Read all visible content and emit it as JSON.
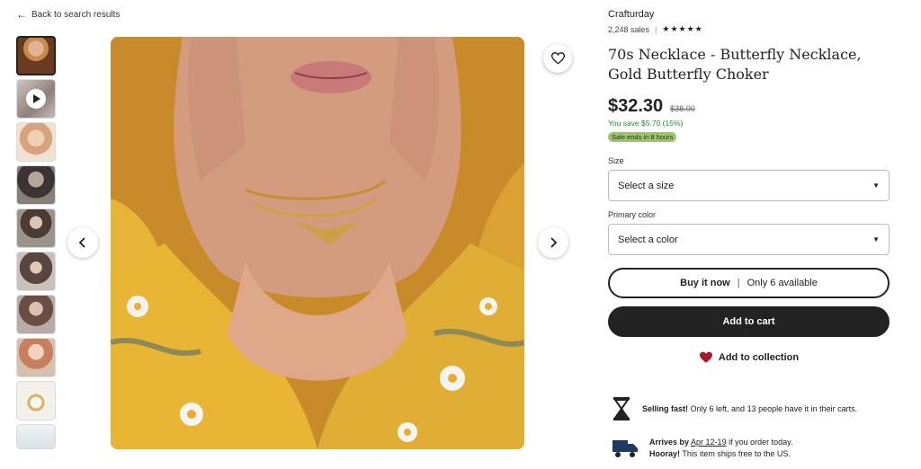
{
  "nav": {
    "back_label": "Back to search results"
  },
  "shop": {
    "name": "Crafturday",
    "sales": "2,248 sales",
    "stars": "★★★★★"
  },
  "product": {
    "title": "70s Necklace - Butterfly Necklace, Gold Butterfly Choker",
    "price": "$32.30",
    "original_price": "$38.00",
    "savings": "You save $5.70 (15%)",
    "sale_badge": "Sale ends in 8 hours"
  },
  "options": {
    "size_label": "Size",
    "size_placeholder": "Select a size",
    "color_label": "Primary color",
    "color_placeholder": "Select a color"
  },
  "actions": {
    "buy_now": "Buy it now",
    "buy_now_stock": "Only 6 available",
    "add_to_cart": "Add to cart",
    "add_to_collection": "Add to collection"
  },
  "info": {
    "selling_fast_bold": "Selling fast!",
    "selling_fast_text": "Only 6 left, and 13 people have it in their carts.",
    "arrives_bold": "Arrives by",
    "arrives_date": "Apr 12-19",
    "arrives_text": "if you order today.",
    "hooray_bold": "Hooray!",
    "hooray_text": "This item ships free to the US."
  },
  "colors": {
    "accent_dark": "#222222",
    "save_green": "#258635",
    "badge_green": "#9ec26f",
    "heart_red": "#a61a2e"
  },
  "icons": [
    "arrow-left-icon",
    "play-icon",
    "heart-outline-icon",
    "chevron-left-icon",
    "chevron-right-icon",
    "caret-down-icon",
    "heart-filled-icon",
    "hourglass-icon",
    "truck-icon"
  ]
}
